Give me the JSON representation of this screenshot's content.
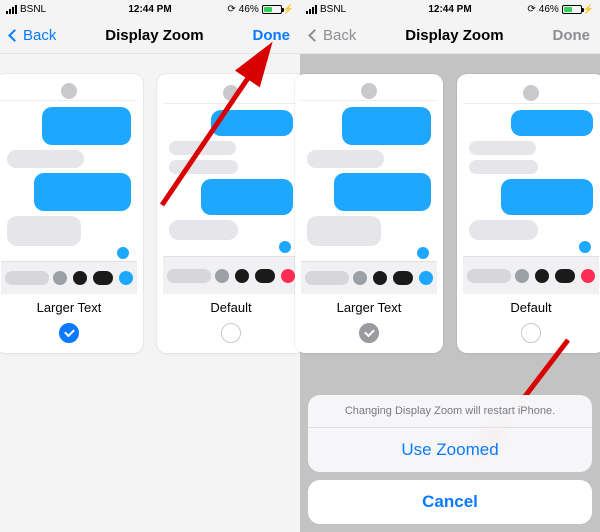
{
  "status": {
    "carrier": "BSNL",
    "time": "12:44 PM",
    "battery_pct": "46%"
  },
  "nav": {
    "back_label": "Back",
    "title": "Display Zoom",
    "done_label": "Done"
  },
  "options": {
    "larger": {
      "label": "Larger Text"
    },
    "default_": {
      "label": "Default"
    }
  },
  "sheet": {
    "message": "Changing Display Zoom will restart iPhone.",
    "confirm": "Use Zoomed",
    "cancel": "Cancel"
  },
  "icons": {
    "charge_glyph": "⚡",
    "refresh_glyph": "⟳"
  }
}
